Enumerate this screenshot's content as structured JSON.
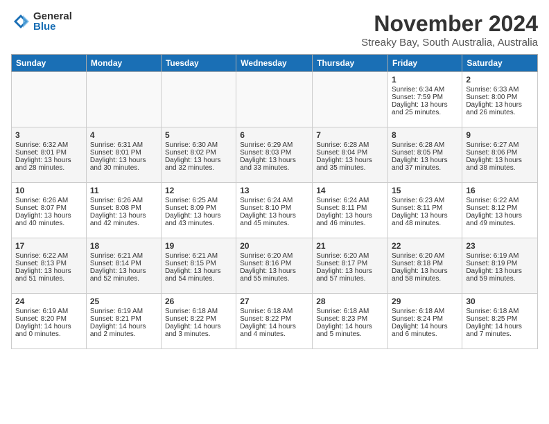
{
  "logo": {
    "general": "General",
    "blue": "Blue"
  },
  "title": "November 2024",
  "subtitle": "Streaky Bay, South Australia, Australia",
  "days_of_week": [
    "Sunday",
    "Monday",
    "Tuesday",
    "Wednesday",
    "Thursday",
    "Friday",
    "Saturday"
  ],
  "weeks": [
    [
      {
        "day": "",
        "content": ""
      },
      {
        "day": "",
        "content": ""
      },
      {
        "day": "",
        "content": ""
      },
      {
        "day": "",
        "content": ""
      },
      {
        "day": "",
        "content": ""
      },
      {
        "day": "1",
        "content": "Sunrise: 6:34 AM\nSunset: 7:59 PM\nDaylight: 13 hours and 25 minutes."
      },
      {
        "day": "2",
        "content": "Sunrise: 6:33 AM\nSunset: 8:00 PM\nDaylight: 13 hours and 26 minutes."
      }
    ],
    [
      {
        "day": "3",
        "content": "Sunrise: 6:32 AM\nSunset: 8:01 PM\nDaylight: 13 hours and 28 minutes."
      },
      {
        "day": "4",
        "content": "Sunrise: 6:31 AM\nSunset: 8:01 PM\nDaylight: 13 hours and 30 minutes."
      },
      {
        "day": "5",
        "content": "Sunrise: 6:30 AM\nSunset: 8:02 PM\nDaylight: 13 hours and 32 minutes."
      },
      {
        "day": "6",
        "content": "Sunrise: 6:29 AM\nSunset: 8:03 PM\nDaylight: 13 hours and 33 minutes."
      },
      {
        "day": "7",
        "content": "Sunrise: 6:28 AM\nSunset: 8:04 PM\nDaylight: 13 hours and 35 minutes."
      },
      {
        "day": "8",
        "content": "Sunrise: 6:28 AM\nSunset: 8:05 PM\nDaylight: 13 hours and 37 minutes."
      },
      {
        "day": "9",
        "content": "Sunrise: 6:27 AM\nSunset: 8:06 PM\nDaylight: 13 hours and 38 minutes."
      }
    ],
    [
      {
        "day": "10",
        "content": "Sunrise: 6:26 AM\nSunset: 8:07 PM\nDaylight: 13 hours and 40 minutes."
      },
      {
        "day": "11",
        "content": "Sunrise: 6:26 AM\nSunset: 8:08 PM\nDaylight: 13 hours and 42 minutes."
      },
      {
        "day": "12",
        "content": "Sunrise: 6:25 AM\nSunset: 8:09 PM\nDaylight: 13 hours and 43 minutes."
      },
      {
        "day": "13",
        "content": "Sunrise: 6:24 AM\nSunset: 8:10 PM\nDaylight: 13 hours and 45 minutes."
      },
      {
        "day": "14",
        "content": "Sunrise: 6:24 AM\nSunset: 8:11 PM\nDaylight: 13 hours and 46 minutes."
      },
      {
        "day": "15",
        "content": "Sunrise: 6:23 AM\nSunset: 8:11 PM\nDaylight: 13 hours and 48 minutes."
      },
      {
        "day": "16",
        "content": "Sunrise: 6:22 AM\nSunset: 8:12 PM\nDaylight: 13 hours and 49 minutes."
      }
    ],
    [
      {
        "day": "17",
        "content": "Sunrise: 6:22 AM\nSunset: 8:13 PM\nDaylight: 13 hours and 51 minutes."
      },
      {
        "day": "18",
        "content": "Sunrise: 6:21 AM\nSunset: 8:14 PM\nDaylight: 13 hours and 52 minutes."
      },
      {
        "day": "19",
        "content": "Sunrise: 6:21 AM\nSunset: 8:15 PM\nDaylight: 13 hours and 54 minutes."
      },
      {
        "day": "20",
        "content": "Sunrise: 6:20 AM\nSunset: 8:16 PM\nDaylight: 13 hours and 55 minutes."
      },
      {
        "day": "21",
        "content": "Sunrise: 6:20 AM\nSunset: 8:17 PM\nDaylight: 13 hours and 57 minutes."
      },
      {
        "day": "22",
        "content": "Sunrise: 6:20 AM\nSunset: 8:18 PM\nDaylight: 13 hours and 58 minutes."
      },
      {
        "day": "23",
        "content": "Sunrise: 6:19 AM\nSunset: 8:19 PM\nDaylight: 13 hours and 59 minutes."
      }
    ],
    [
      {
        "day": "24",
        "content": "Sunrise: 6:19 AM\nSunset: 8:20 PM\nDaylight: 14 hours and 0 minutes."
      },
      {
        "day": "25",
        "content": "Sunrise: 6:19 AM\nSunset: 8:21 PM\nDaylight: 14 hours and 2 minutes."
      },
      {
        "day": "26",
        "content": "Sunrise: 6:18 AM\nSunset: 8:22 PM\nDaylight: 14 hours and 3 minutes."
      },
      {
        "day": "27",
        "content": "Sunrise: 6:18 AM\nSunset: 8:22 PM\nDaylight: 14 hours and 4 minutes."
      },
      {
        "day": "28",
        "content": "Sunrise: 6:18 AM\nSunset: 8:23 PM\nDaylight: 14 hours and 5 minutes."
      },
      {
        "day": "29",
        "content": "Sunrise: 6:18 AM\nSunset: 8:24 PM\nDaylight: 14 hours and 6 minutes."
      },
      {
        "day": "30",
        "content": "Sunrise: 6:18 AM\nSunset: 8:25 PM\nDaylight: 14 hours and 7 minutes."
      }
    ]
  ]
}
